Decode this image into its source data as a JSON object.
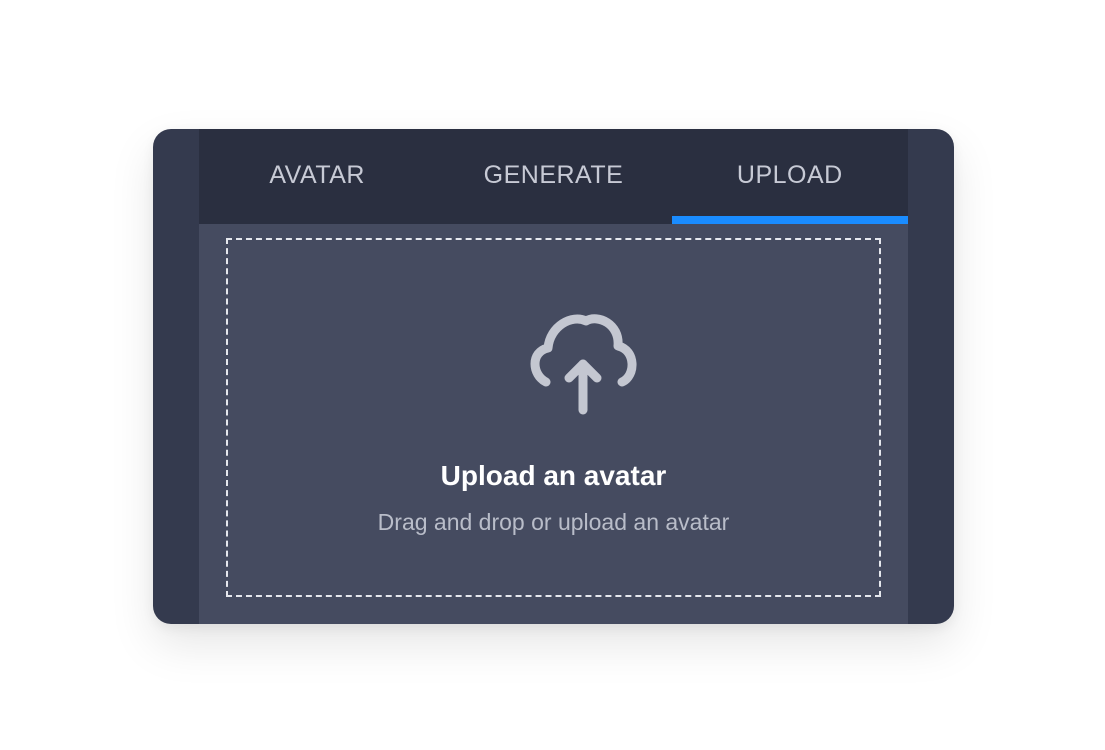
{
  "tabs": [
    {
      "label": "AVATAR",
      "active": false
    },
    {
      "label": "GENERATE",
      "active": false
    },
    {
      "label": "UPLOAD",
      "active": true
    }
  ],
  "dropzone": {
    "icon": "cloud-upload-icon",
    "title": "Upload an avatar",
    "subtitle": "Drag and drop or upload an avatar"
  },
  "colors": {
    "accent": "#1a8cff",
    "card_background": "#343a4e",
    "tab_bar_background": "#2a2f40",
    "content_background": "#454b60",
    "tab_text": "#c7cad5",
    "icon": "#c4c7d1"
  }
}
